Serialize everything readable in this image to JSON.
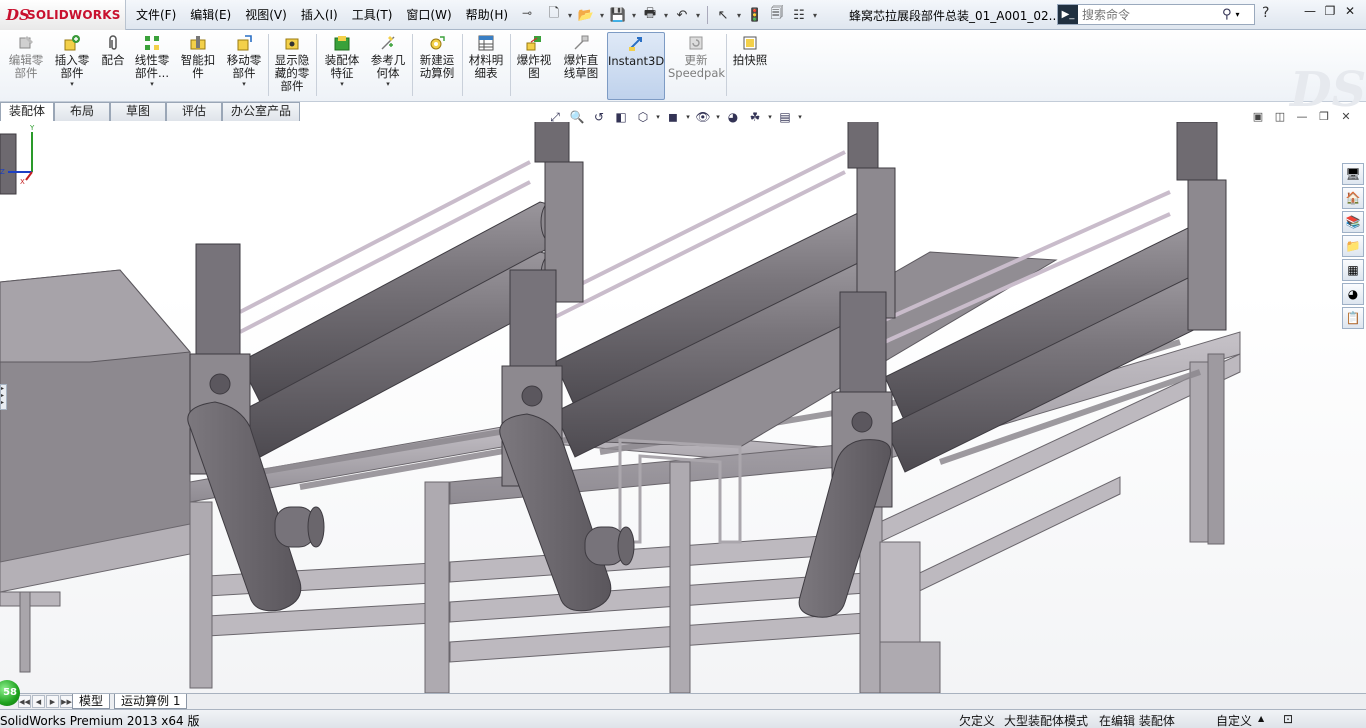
{
  "titlebar": {
    "brand": "SOLIDWORKS",
    "menu": [
      "文件(F)",
      "编辑(E)",
      "视图(V)",
      "插入(I)",
      "工具(T)",
      "窗口(W)",
      "帮助(H)"
    ],
    "document_title": "蜂窝芯拉展段部件总装_01_A001_02...",
    "search_placeholder": "搜索命令",
    "help": "?"
  },
  "ribbon": {
    "commands": [
      {
        "label1": "编辑零",
        "label2": "部件",
        "label3": "",
        "disabled": true
      },
      {
        "label1": "插入零",
        "label2": "部件",
        "label3": "",
        "disabled": false
      },
      {
        "label1": "配合",
        "label2": "",
        "label3": "",
        "disabled": false
      },
      {
        "label1": "线性零",
        "label2": "部件...",
        "label3": "",
        "disabled": false
      },
      {
        "label1": "智能扣",
        "label2": "件",
        "label3": "",
        "disabled": false
      },
      {
        "label1": "移动零",
        "label2": "部件",
        "label3": "",
        "disabled": false
      },
      {
        "label1": "显示隐",
        "label2": "藏的零",
        "label3": "部件",
        "disabled": false
      },
      {
        "label1": "装配体",
        "label2": "特征",
        "label3": "",
        "disabled": false
      },
      {
        "label1": "参考几",
        "label2": "何体",
        "label3": "",
        "disabled": false
      },
      {
        "label1": "新建运",
        "label2": "动算例",
        "label3": "",
        "disabled": false
      },
      {
        "label1": "材料明",
        "label2": "细表",
        "label3": "",
        "disabled": false
      },
      {
        "label1": "爆炸视",
        "label2": "图",
        "label3": "",
        "disabled": false
      },
      {
        "label1": "爆炸直",
        "label2": "线草图",
        "label3": "",
        "disabled": false
      },
      {
        "label1": "Instant3D",
        "label2": "",
        "label3": "",
        "disabled": false
      },
      {
        "label1": "更新",
        "label2": "Speedpak",
        "label3": "",
        "disabled": true
      },
      {
        "label1": "拍快照",
        "label2": "",
        "label3": "",
        "disabled": false
      }
    ]
  },
  "tabs": [
    "装配体",
    "布局",
    "草图",
    "评估",
    "办公室产品"
  ],
  "bottom_tabs": [
    "模型",
    "运动算例 1"
  ],
  "status": {
    "app": "SolidWorks Premium 2013 x64 版",
    "underdefined": "欠定义",
    "large_assembly": "大型装配体模式",
    "editing": "在编辑 装配体",
    "custom": "自定义"
  },
  "rebuild_count": "58",
  "colors": {
    "brand": "#c8102e",
    "steel": "#8e8a90",
    "steel_dark": "#5f5b62",
    "roller": "#6e6a70",
    "frame": "#b9b5bb"
  },
  "icons": {
    "search": "magnifier-icon",
    "help": "help-icon"
  }
}
